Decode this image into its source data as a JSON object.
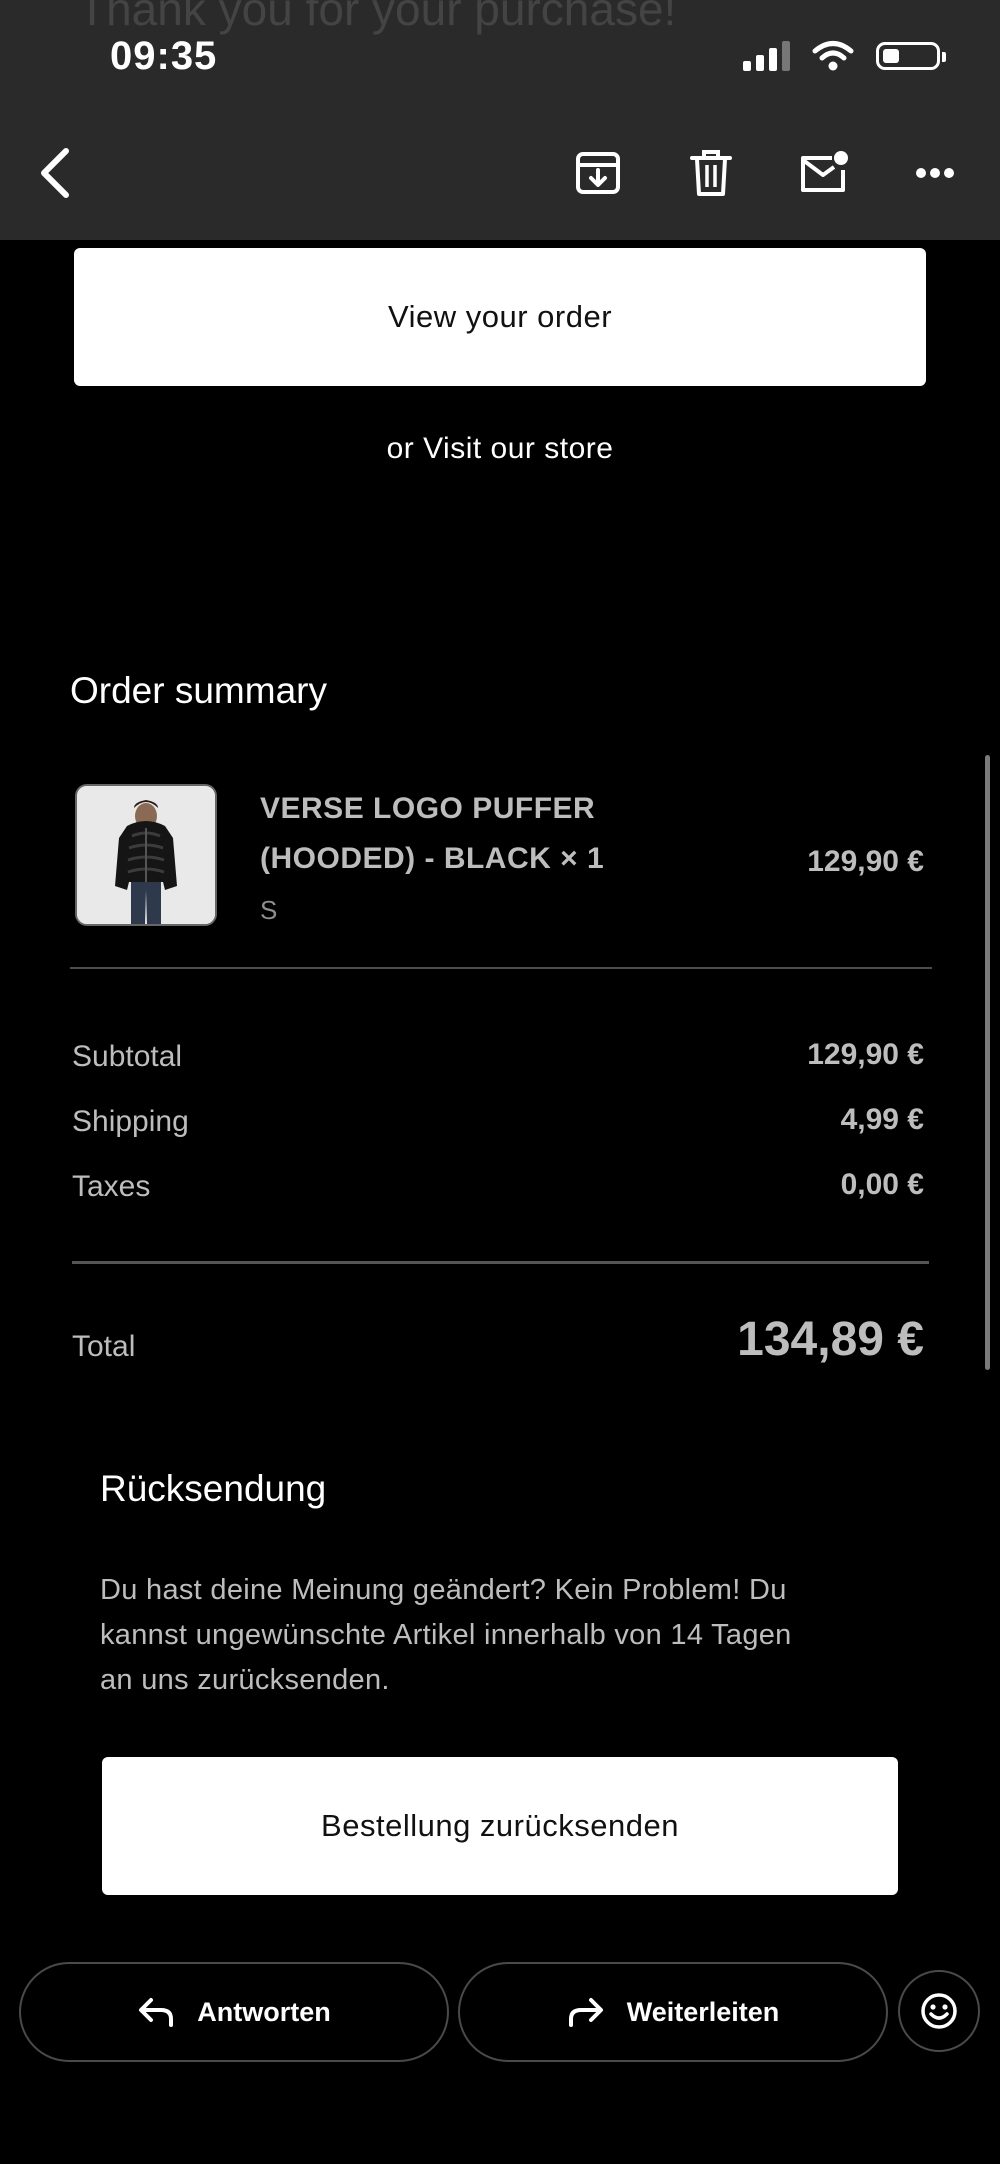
{
  "header": {
    "ghost_title": "Thank you for your purchase!",
    "status_time": "09:35"
  },
  "actions": {
    "view_order": "View your order",
    "visit_store": "or Visit our store"
  },
  "order": {
    "heading": "Order summary",
    "item": {
      "name_line1": "VERSE LOGO PUFFER",
      "name_line2": "(HOODED) - BLACK × 1",
      "variant": "S",
      "price": "129,90 €"
    },
    "subtotal_label": "Subtotal",
    "subtotal_value": "129,90 €",
    "shipping_label": "Shipping",
    "shipping_value": "4,99 €",
    "taxes_label": "Taxes",
    "taxes_value": "0,00 €",
    "total_label": "Total",
    "total_value": "134,89 €"
  },
  "returns": {
    "heading": "Rücksendung",
    "text_line1": "Du hast deine Meinung geändert? Kein Problem! Du",
    "text_line2": "kannst ungewünschte Artikel innerhalb von 14 Tagen",
    "text_line3": "an uns zurücksenden.",
    "button": "Bestellung zurücksenden"
  },
  "bottom_bar": {
    "reply": "Antworten",
    "forward": "Weiterleiten"
  },
  "icons": {
    "back": "chevron-left-icon",
    "archive": "archive-icon",
    "trash": "trash-icon",
    "mail_unread": "mail-unread-icon",
    "more": "more-icon",
    "reply": "reply-icon",
    "forward": "forward-icon",
    "emoji": "emoji-icon"
  }
}
